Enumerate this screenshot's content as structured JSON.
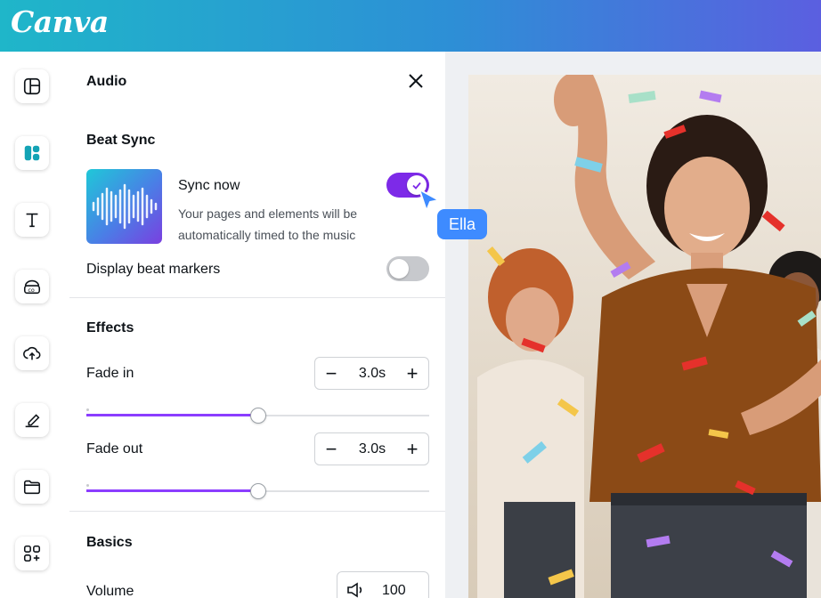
{
  "header": {
    "logo_text": "Canva"
  },
  "sidebar": {
    "items": [
      {
        "icon": "layout-icon"
      },
      {
        "icon": "elements-icon",
        "active": true
      },
      {
        "icon": "text-icon"
      },
      {
        "icon": "brand-icon"
      },
      {
        "icon": "upload-cloud-icon"
      },
      {
        "icon": "draw-icon"
      },
      {
        "icon": "folder-icon"
      },
      {
        "icon": "apps-icon"
      }
    ]
  },
  "panel": {
    "title": "Audio",
    "beat_sync": {
      "heading": "Beat Sync",
      "sync_label": "Sync now",
      "sync_description": "Your pages and elements will be automatically timed to the music",
      "sync_on": true,
      "markers_label": "Display beat markers",
      "markers_on": false
    },
    "effects": {
      "heading": "Effects",
      "fade_in": {
        "label": "Fade in",
        "value": "3.0s",
        "slider_fraction": 0.5
      },
      "fade_out": {
        "label": "Fade out",
        "value": "3.0s",
        "slider_fraction": 0.5
      },
      "minus_symbol": "−",
      "plus_symbol": "+"
    },
    "basics": {
      "heading": "Basics",
      "volume_label": "Volume",
      "volume_value": "100"
    }
  },
  "collaborator": {
    "name": "Ella",
    "color": "#3e8bff"
  },
  "colors": {
    "accent": "#7d2ae8",
    "toggle_off": "#c7c9cd"
  }
}
